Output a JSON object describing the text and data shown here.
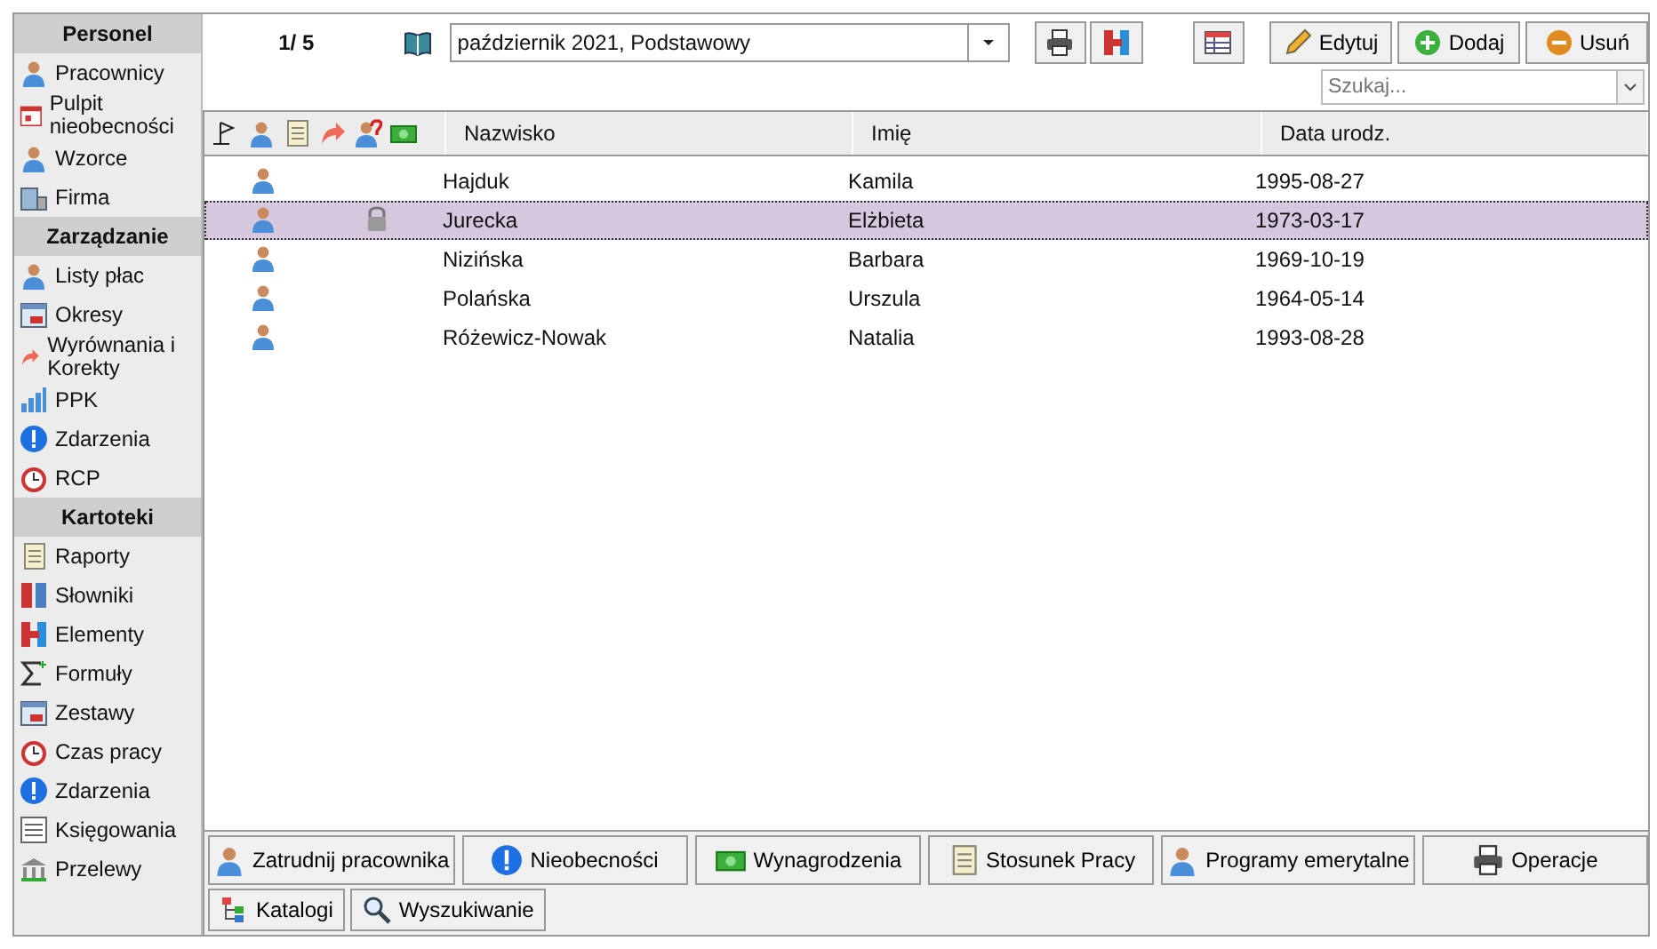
{
  "sidebar": {
    "sections": [
      {
        "title": "Personel",
        "items": [
          {
            "label": "Pracownicy"
          },
          {
            "label": "Pulpit nieobecności"
          },
          {
            "label": "Wzorce"
          },
          {
            "label": "Firma"
          }
        ]
      },
      {
        "title": "Zarządzanie",
        "items": [
          {
            "label": "Listy płac"
          },
          {
            "label": "Okresy"
          },
          {
            "label": "Wyrównania i Korekty"
          },
          {
            "label": "PPK"
          },
          {
            "label": "Zdarzenia"
          },
          {
            "label": "RCP"
          }
        ]
      },
      {
        "title": "Kartoteki",
        "items": [
          {
            "label": "Raporty"
          },
          {
            "label": "Słowniki"
          },
          {
            "label": "Elementy"
          },
          {
            "label": "Formuły"
          },
          {
            "label": "Zestawy"
          },
          {
            "label": "Czas pracy"
          },
          {
            "label": "Zdarzenia"
          },
          {
            "label": "Księgowania"
          },
          {
            "label": "Przelewy"
          }
        ]
      }
    ]
  },
  "toolbar": {
    "counter": "1/ 5",
    "period": "październik 2021, Podstawowy",
    "buttons": [
      {
        "label": "Edytuj"
      },
      {
        "label": "Dodaj"
      },
      {
        "label": "Usuń"
      }
    ]
  },
  "search": {
    "placeholder": "Szukaj..."
  },
  "table": {
    "columns": [
      "Nazwisko",
      "Imię",
      "Data urodz."
    ],
    "rows": [
      {
        "cells": [
          "Hajduk",
          "Kamila",
          "1995-08-27"
        ],
        "locked": false,
        "selected": false
      },
      {
        "cells": [
          "Jurecka",
          "Elżbieta",
          "1973-03-17"
        ],
        "locked": true,
        "selected": true
      },
      {
        "cells": [
          "Nizińska",
          "Barbara",
          "1969-10-19"
        ],
        "locked": false,
        "selected": false
      },
      {
        "cells": [
          "Polańska",
          "Urszula",
          "1964-05-14"
        ],
        "locked": false,
        "selected": false
      },
      {
        "cells": [
          "Różewicz-Nowak",
          "Natalia",
          "1993-08-28"
        ],
        "locked": false,
        "selected": false
      }
    ]
  },
  "actions": [
    {
      "label": "Zatrudnij pracownika"
    },
    {
      "label": "Nieobecności"
    },
    {
      "label": "Wynagrodzenia"
    },
    {
      "label": "Stosunek Pracy"
    },
    {
      "label": "Programy emerytalne"
    },
    {
      "label": "Operacje"
    }
  ],
  "actions_2": [
    {
      "label": "Katalogi"
    },
    {
      "label": "Wyszukiwanie"
    }
  ]
}
